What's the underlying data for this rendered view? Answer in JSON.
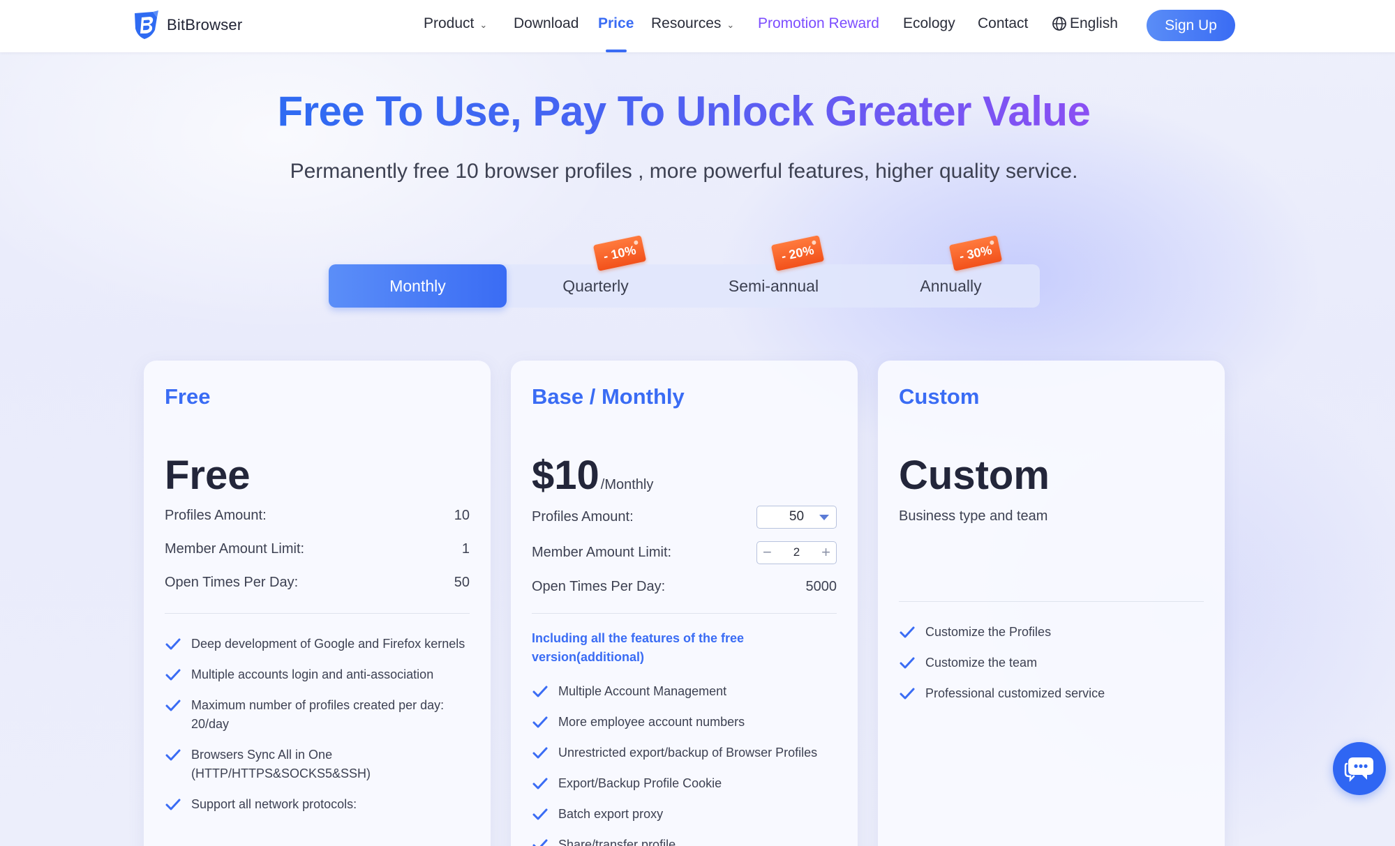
{
  "nav": {
    "brand": "BitBrowser",
    "items": [
      {
        "label": "Product",
        "dropdown": true
      },
      {
        "label": "Download",
        "dropdown": false
      },
      {
        "label": "Price",
        "dropdown": false,
        "active": true
      },
      {
        "label": "Resources",
        "dropdown": true
      },
      {
        "label": "Promotion Reward",
        "dropdown": false
      },
      {
        "label": "Ecology",
        "dropdown": false
      },
      {
        "label": "Contact",
        "dropdown": false
      }
    ],
    "language": "English",
    "signup_label": "Sign Up"
  },
  "hero": {
    "title": "Free To Use, Pay To Unlock Greater Value",
    "subtitle": "Permanently free 10 browser profiles , more powerful features, higher quality service."
  },
  "billing": {
    "tabs": [
      {
        "label": "Monthly",
        "selected": true,
        "discount": ""
      },
      {
        "label": "Quarterly",
        "selected": false,
        "discount": "- 10%"
      },
      {
        "label": "Semi-annual",
        "selected": false,
        "discount": "- 20%"
      },
      {
        "label": "Annually",
        "selected": false,
        "discount": "- 30%"
      }
    ]
  },
  "plans": {
    "free": {
      "title": "Free",
      "price": "Free",
      "profiles_label": "Profiles Amount:",
      "profiles_value": "10",
      "members_label": "Member Amount Limit:",
      "members_value": "1",
      "open_label": "Open Times Per Day:",
      "open_value": "50",
      "features": [
        "Deep development of Google and Firefox kernels",
        "Multiple accounts login and anti-association",
        "Maximum number of profiles created per day: 20/day",
        "Browsers Sync All in One (HTTP/HTTPS&SOCKS5&SSH)",
        "Support all network protocols:"
      ]
    },
    "base": {
      "title": "Base / Monthly",
      "price": "$10",
      "price_unit": "/Monthly",
      "profiles_label": "Profiles Amount:",
      "profiles_value": "50",
      "members_label": "Member Amount Limit:",
      "members_value": "2",
      "stepper_minus": "−",
      "stepper_plus": "+",
      "open_label": "Open Times Per Day:",
      "open_value": "5000",
      "highlight": "Including all the features of the free version(additional)",
      "features": [
        "Multiple Account Management",
        "More employee account numbers",
        "Unrestricted export/backup of Browser Profiles",
        "Export/Backup Profile Cookie",
        "Batch export proxy",
        "Share/transfer profile"
      ]
    },
    "custom": {
      "title": "Custom",
      "price": "Custom",
      "description": "Business type and team",
      "features": [
        "Customize the Profiles",
        "Customize the team",
        "Professional customized service"
      ]
    }
  },
  "colors": {
    "accent": "#3a6cf4",
    "promo": "#7c4dff",
    "discount_tag": "#f2511b"
  },
  "icons": {
    "logo": "bitbrowser-shield-logo",
    "language": "globe-icon",
    "feature": "check-icon",
    "chat": "chat-bubble-icon"
  }
}
